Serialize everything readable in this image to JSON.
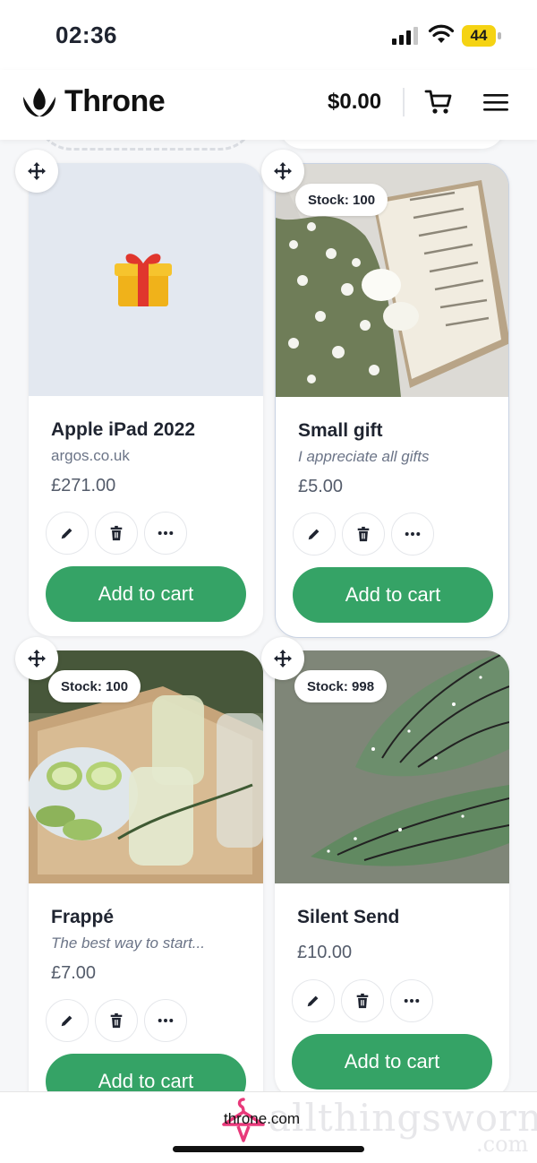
{
  "status_bar": {
    "time": "02:36",
    "battery": "44",
    "battery_color": "#f5d313"
  },
  "header": {
    "brand": "Throne",
    "balance": "$0.00",
    "icons": [
      "throne-logo-icon",
      "cart-icon",
      "menu-icon"
    ]
  },
  "colors": {
    "accent": "#35a366",
    "placeholder_bg": "#e3e8f0"
  },
  "products": [
    {
      "title": "Apple iPad 2022",
      "subtitle": "argos.co.uk",
      "price": "£271.00",
      "button": "Add to cart",
      "image": "gift-box-icon"
    },
    {
      "stock": "Stock: 100",
      "title": "Small gift",
      "subtitle": "I appreciate all gifts",
      "price": "£5.00",
      "button": "Add to cart",
      "image": "book-and-flowers-photo"
    },
    {
      "stock": "Stock: 100",
      "title": "Frappé",
      "subtitle": "The best way to start...",
      "price": "£7.00",
      "button": "Add to cart",
      "image": "iced-drinks-photo"
    },
    {
      "stock": "Stock: 998",
      "title": "Silent Send",
      "price": "£10.00",
      "button": "Add to cart",
      "image": "fairy-wings-photo"
    }
  ],
  "footer": {
    "brand": "throne.com",
    "watermark": "allthingsworn",
    "watermark_sub": ".com"
  }
}
